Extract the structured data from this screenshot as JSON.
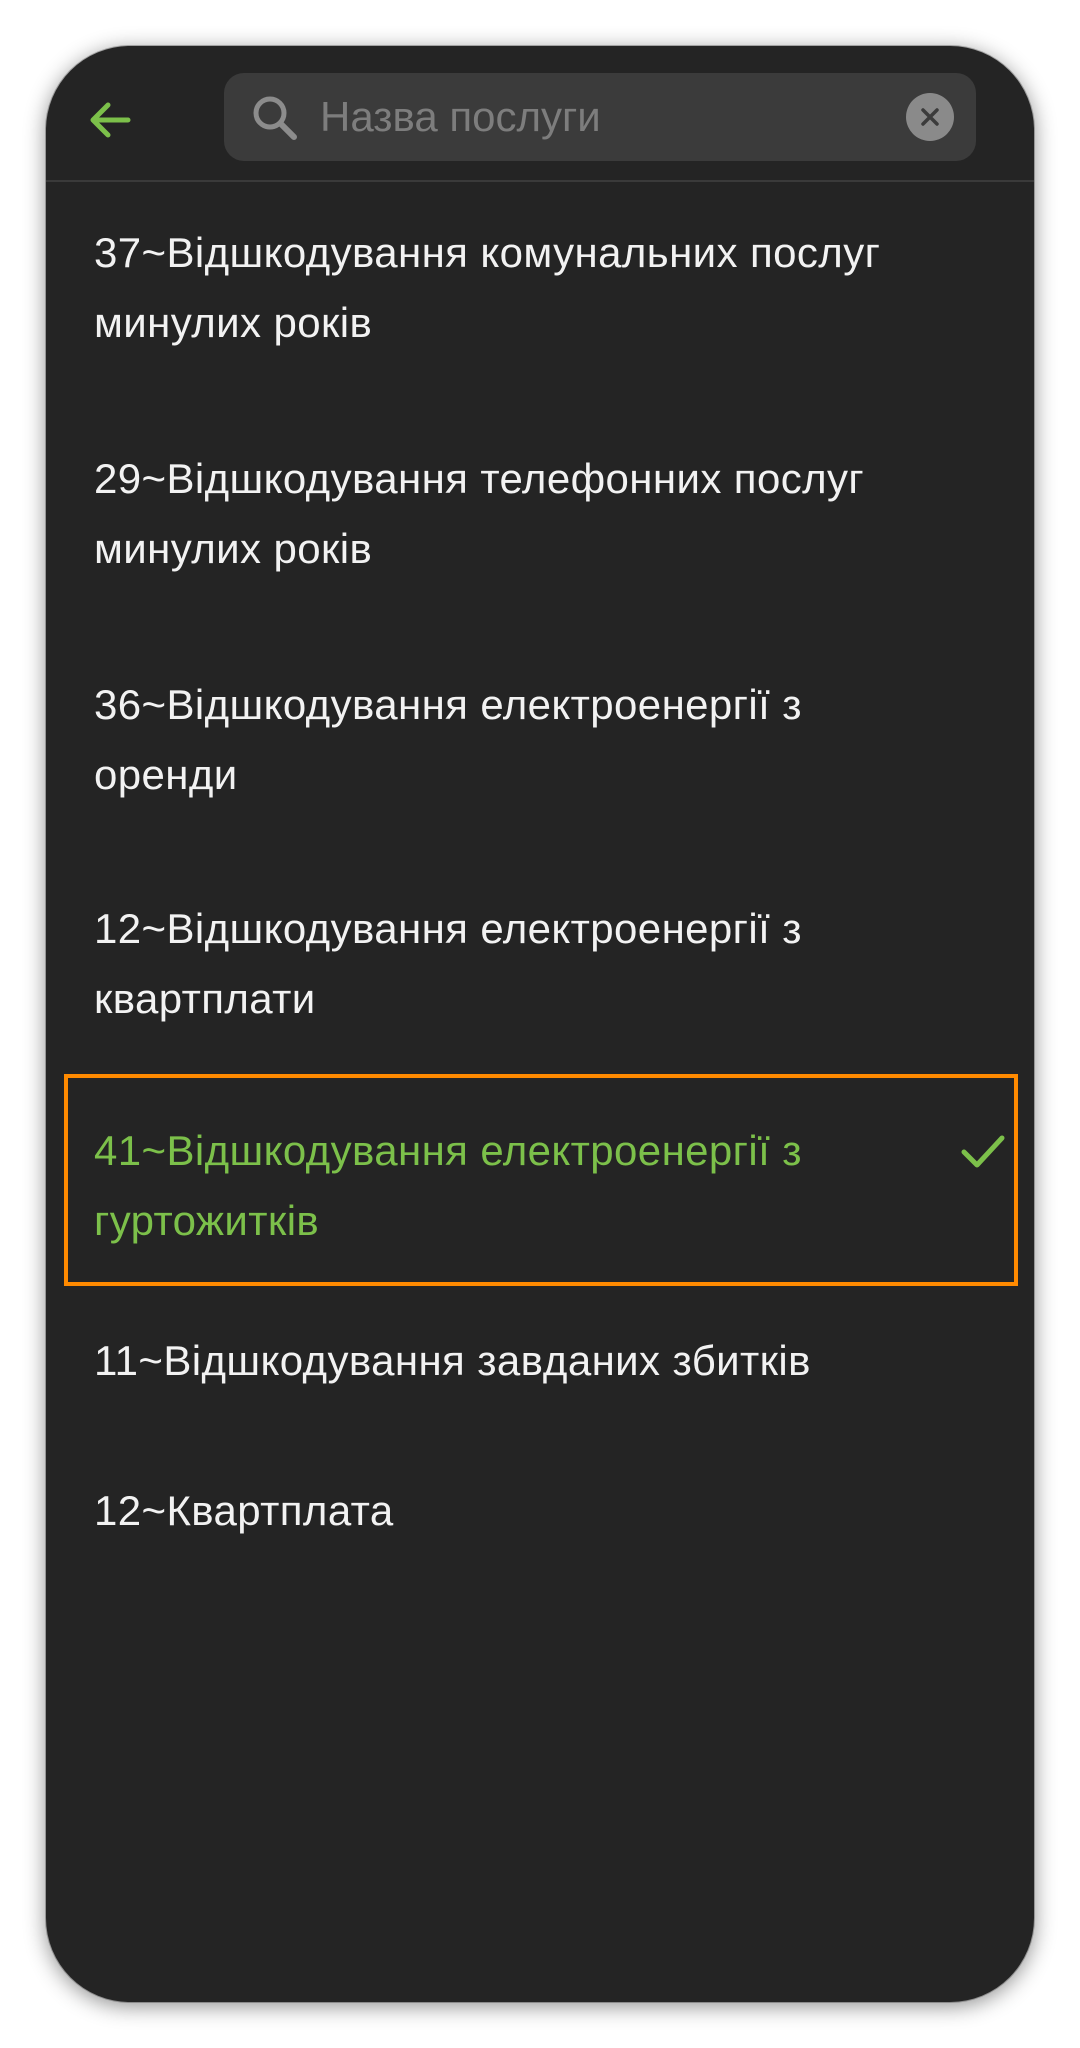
{
  "header": {
    "back_icon": "arrow-left-icon",
    "search": {
      "placeholder": "Назва послуги",
      "value": "",
      "search_icon": "magnifier-icon",
      "clear_icon": "clear-circle-icon"
    }
  },
  "services": [
    {
      "label": "37~Відшкодування комунальних послуг минулих років",
      "selected": false
    },
    {
      "label": "29~Відшкодування телефонних послуг минулих років",
      "selected": false
    },
    {
      "label": "36~Відшкодування електроенергії з оренди",
      "selected": false
    },
    {
      "label": "12~Відшкодування електроенергії з квартплати",
      "selected": false
    },
    {
      "label": "41~Відшкодування електроенергії з гуртожитків",
      "selected": true
    },
    {
      "label": "11~Відшкодування завданих збитків",
      "selected": false
    },
    {
      "label": "12~Квартплата",
      "selected": false
    }
  ],
  "colors": {
    "background": "#242424",
    "accent": "#7cc04a",
    "highlight": "#ff8a00",
    "text": "#f2f2f2"
  },
  "selected_icon": "checkmark-icon"
}
